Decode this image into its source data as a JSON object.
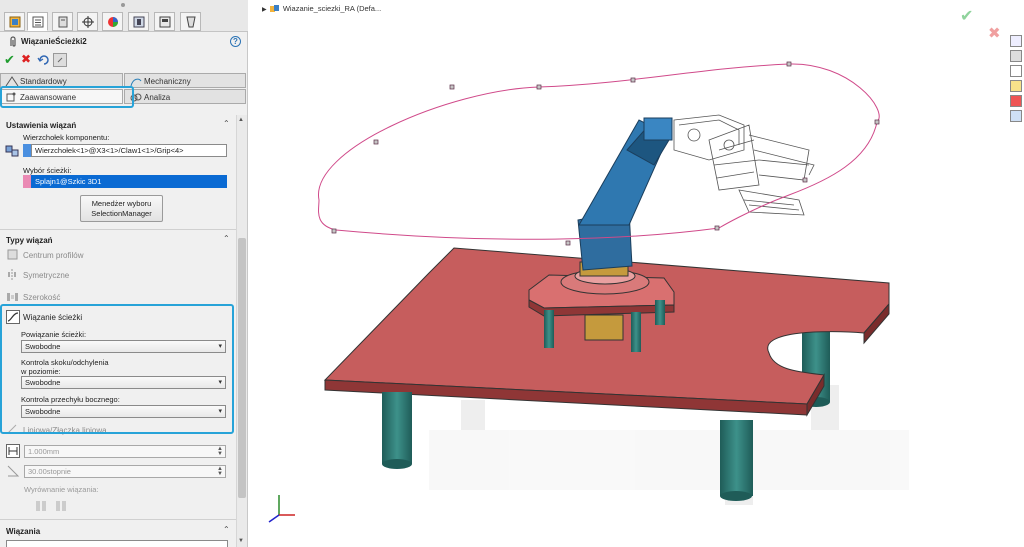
{
  "property_manager": {
    "title": "WiązanieŚcieżki2",
    "help": "?",
    "tabs": {
      "standard": "Standardowy",
      "mechanical": "Mechaniczny",
      "advanced": "Zaawansowane",
      "analysis": "Analiza"
    },
    "mate_settings": {
      "header": "Ustawienia wiązań",
      "vertex_label": "Wierzchołek komponentu:",
      "vertex_value": "Wierzchołek<1>@X3<1>/Claw1<1>/Grip<4>",
      "path_label": "Wybór ścieżki:",
      "path_value": "Splajn1@Szkic 3D1",
      "selection_manager_line1": "Menedżer wyboru",
      "selection_manager_line2": "SelectionManager"
    },
    "mate_types": {
      "header": "Typy wiązań",
      "items": [
        "Centrum profilów",
        "Symetryczne",
        "Szerokość",
        "Wiązanie ścieżki"
      ],
      "path_constraint_label": "Powiązanie ścieżki:",
      "path_constraint_value": "Swobodne",
      "pitch_yaw_label_1": "Kontrola skoku/odchylenia",
      "pitch_yaw_label_2": "w poziomie:",
      "pitch_yaw_value": "Swobodne",
      "roll_label": "Kontrola przechyłu bocznego:",
      "roll_value": "Swobodne",
      "linear_coupler": "Liniowa/Złączka liniowa"
    },
    "distance_value": "1.000mm",
    "angle_value": "30.00stopnie",
    "alignment_label": "Wyrównanie wiązania:",
    "mates_header": "Wiązania"
  },
  "tree": {
    "title": "Wiazanie_sciezki_RA (Defa..."
  },
  "colors": {
    "highlight": "#27a3d8",
    "table_top": "#c25a5a",
    "legs": "#2e7d78",
    "robot_blue": "#2f6d9f",
    "spline": "#d04a8a"
  }
}
